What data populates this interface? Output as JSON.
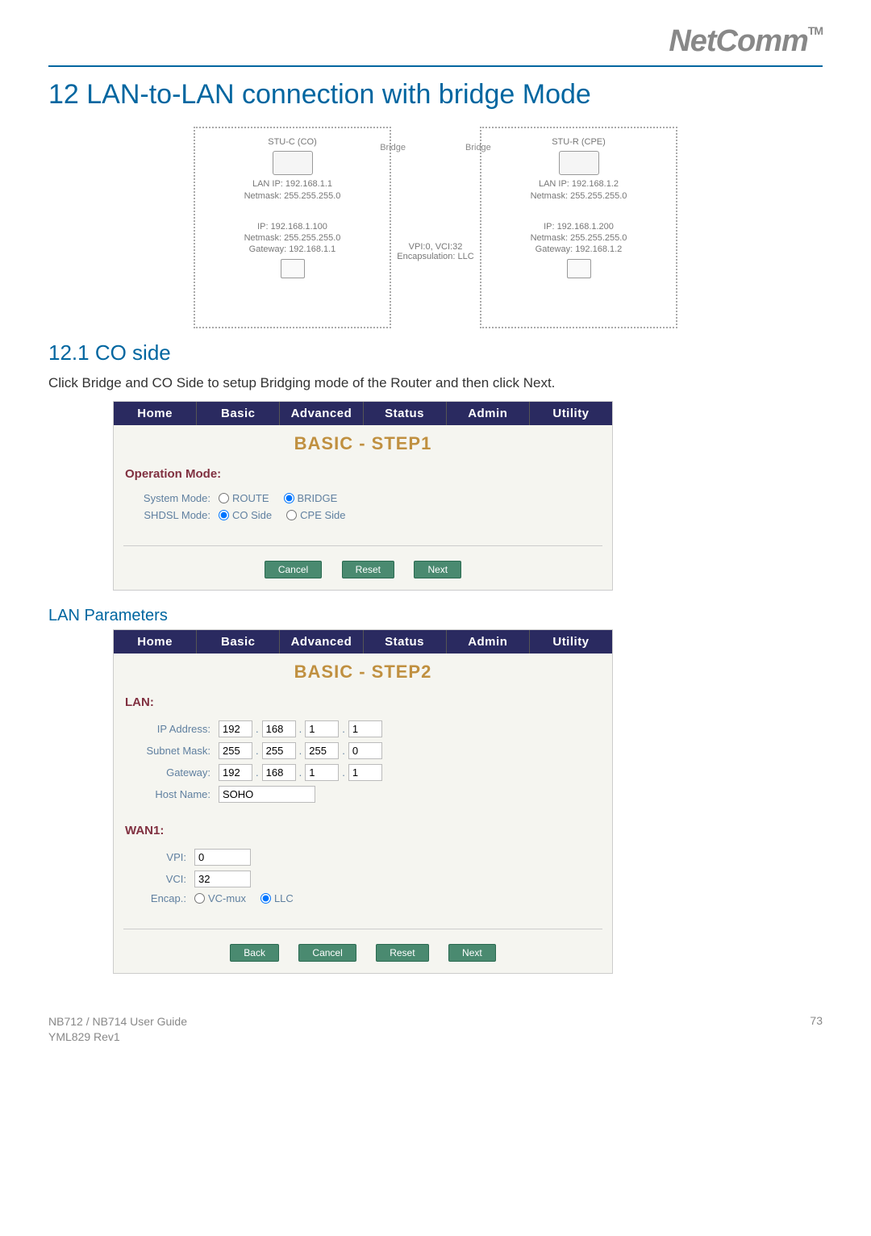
{
  "header": {
    "logo": "NetComm",
    "tm": "TM"
  },
  "h1": "12 LAN-to-LAN connection with bridge Mode",
  "diagram": {
    "stuC": "STU-C (CO)",
    "stuR": "STU-R (CPE)",
    "bridge": "Bridge",
    "lanLeft": "LAN IP: 192.168.1.1\nNetmask: 255.255.255.0",
    "lanRight": "LAN IP: 192.168.1.2\nNetmask: 255.255.255.0",
    "pcLeft": "IP: 192.168.1.100\nNetmask: 255.255.255.0\nGateway: 192.168.1.1",
    "pcRight": "IP: 192.168.1.200\nNetmask: 255.255.255.0\nGateway: 192.168.1.2",
    "center": "VPI:0, VCI:32\nEncapsulation: LLC"
  },
  "h2": "12.1 CO side",
  "intro": "Click Bridge and CO Side to setup Bridging mode of the Router and then click Next.",
  "tabs": [
    "Home",
    "Basic",
    "Advanced",
    "Status",
    "Admin",
    "Utility"
  ],
  "step1": {
    "title": "BASIC - STEP1",
    "opMode": "Operation Mode:",
    "sysModeLabel": "System Mode:",
    "sysMode": {
      "route": "ROUTE",
      "bridge": "BRIDGE"
    },
    "shdslLabel": "SHDSL Mode:",
    "shdsl": {
      "co": "CO Side",
      "cpe": "CPE Side"
    },
    "buttons": {
      "cancel": "Cancel",
      "reset": "Reset",
      "next": "Next"
    }
  },
  "h3": "LAN Parameters",
  "step2": {
    "title": "BASIC - STEP2",
    "lanLabel": "LAN:",
    "ipLabel": "IP Address:",
    "ip": [
      "192",
      "168",
      "1",
      "1"
    ],
    "maskLabel": "Subnet Mask:",
    "mask": [
      "255",
      "255",
      "255",
      "0"
    ],
    "gwLabel": "Gateway:",
    "gw": [
      "192",
      "168",
      "1",
      "1"
    ],
    "hostLabel": "Host Name:",
    "host": "SOHO",
    "wan1Label": "WAN1:",
    "vpiLabel": "VPI:",
    "vpi": "0",
    "vciLabel": "VCI:",
    "vci": "32",
    "encapLabel": "Encap.:",
    "encap": {
      "vcmux": "VC-mux",
      "llc": "LLC"
    },
    "buttons": {
      "back": "Back",
      "cancel": "Cancel",
      "reset": "Reset",
      "next": "Next"
    }
  },
  "footer": {
    "guide": "NB712 / NB714 User Guide",
    "rev": "YML829 Rev1",
    "page": "73"
  }
}
